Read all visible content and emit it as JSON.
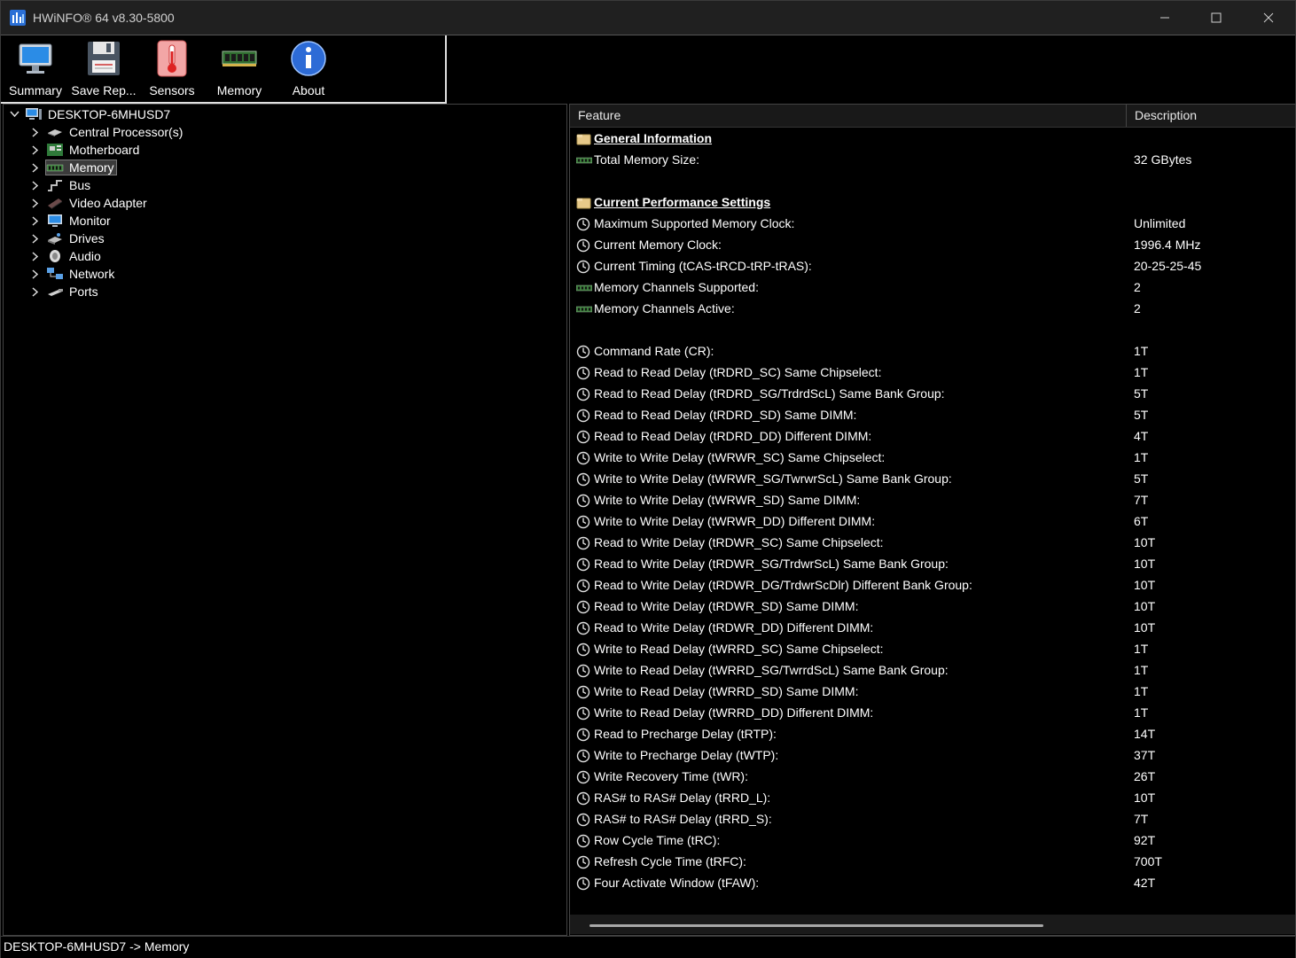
{
  "window": {
    "title": "HWiNFO® 64 v8.30-5800"
  },
  "toolbar": {
    "buttons": [
      {
        "label": "Summary",
        "icon": "monitor-icon"
      },
      {
        "label": "Save Rep...",
        "icon": "floppy-disk-icon"
      },
      {
        "label": "Sensors",
        "icon": "thermometer-icon"
      },
      {
        "label": "Memory",
        "icon": "memory-module-icon"
      },
      {
        "label": "About",
        "icon": "info-icon"
      }
    ]
  },
  "tree": {
    "root": {
      "label": "DESKTOP-6MHUSD7",
      "icon": "computer-icon",
      "expanded": true
    },
    "items": [
      {
        "label": "Central Processor(s)",
        "icon": "cpu-icon"
      },
      {
        "label": "Motherboard",
        "icon": "motherboard-icon"
      },
      {
        "label": "Memory",
        "icon": "memory-module-icon",
        "selected": true
      },
      {
        "label": "Bus",
        "icon": "bus-icon"
      },
      {
        "label": "Video Adapter",
        "icon": "video-card-icon"
      },
      {
        "label": "Monitor",
        "icon": "monitor-icon"
      },
      {
        "label": "Drives",
        "icon": "drive-icon"
      },
      {
        "label": "Audio",
        "icon": "speaker-icon"
      },
      {
        "label": "Network",
        "icon": "network-icon"
      },
      {
        "label": "Ports",
        "icon": "port-icon"
      }
    ]
  },
  "list": {
    "headers": {
      "feature": "Feature",
      "description": "Description"
    },
    "rows": [
      {
        "type": "section",
        "icon": "folder-icon",
        "feature": "General Information",
        "value": ""
      },
      {
        "type": "item",
        "icon": "memory-module-icon",
        "feature": "Total Memory Size:",
        "value": "32 GBytes"
      },
      {
        "type": "blank"
      },
      {
        "type": "section",
        "icon": "folder-icon",
        "feature": "Current Performance Settings",
        "value": ""
      },
      {
        "type": "item",
        "icon": "clock-icon",
        "feature": "Maximum Supported Memory Clock:",
        "value": "Unlimited"
      },
      {
        "type": "item",
        "icon": "clock-icon",
        "feature": "Current Memory Clock:",
        "value": "1996.4 MHz"
      },
      {
        "type": "item",
        "icon": "clock-icon",
        "feature": "Current Timing (tCAS-tRCD-tRP-tRAS):",
        "value": "20-25-25-45"
      },
      {
        "type": "item",
        "icon": "memory-module-icon",
        "feature": "Memory Channels Supported:",
        "value": "2"
      },
      {
        "type": "item",
        "icon": "memory-module-icon",
        "feature": "Memory Channels Active:",
        "value": "2"
      },
      {
        "type": "blank"
      },
      {
        "type": "item",
        "icon": "clock-icon",
        "feature": "Command Rate (CR):",
        "value": "1T"
      },
      {
        "type": "item",
        "icon": "clock-icon",
        "feature": "Read to Read Delay (tRDRD_SC) Same Chipselect:",
        "value": "1T"
      },
      {
        "type": "item",
        "icon": "clock-icon",
        "feature": "Read to Read Delay (tRDRD_SG/TrdrdScL) Same Bank Group:",
        "value": "5T"
      },
      {
        "type": "item",
        "icon": "clock-icon",
        "feature": "Read to Read Delay (tRDRD_SD) Same DIMM:",
        "value": "5T"
      },
      {
        "type": "item",
        "icon": "clock-icon",
        "feature": "Read to Read Delay (tRDRD_DD) Different DIMM:",
        "value": "4T"
      },
      {
        "type": "item",
        "icon": "clock-icon",
        "feature": "Write to Write Delay (tWRWR_SC) Same Chipselect:",
        "value": "1T"
      },
      {
        "type": "item",
        "icon": "clock-icon",
        "feature": "Write to Write Delay (tWRWR_SG/TwrwrScL) Same Bank Group:",
        "value": "5T"
      },
      {
        "type": "item",
        "icon": "clock-icon",
        "feature": "Write to Write Delay (tWRWR_SD) Same DIMM:",
        "value": "7T"
      },
      {
        "type": "item",
        "icon": "clock-icon",
        "feature": "Write to Write Delay (tWRWR_DD) Different DIMM:",
        "value": "6T"
      },
      {
        "type": "item",
        "icon": "clock-icon",
        "feature": "Read to Write Delay (tRDWR_SC) Same Chipselect:",
        "value": "10T"
      },
      {
        "type": "item",
        "icon": "clock-icon",
        "feature": "Read to Write Delay (tRDWR_SG/TrdwrScL) Same Bank Group:",
        "value": "10T"
      },
      {
        "type": "item",
        "icon": "clock-icon",
        "feature": "Read to Write Delay (tRDWR_DG/TrdwrScDlr) Different Bank Group:",
        "value": "10T"
      },
      {
        "type": "item",
        "icon": "clock-icon",
        "feature": "Read to Write Delay (tRDWR_SD) Same DIMM:",
        "value": "10T"
      },
      {
        "type": "item",
        "icon": "clock-icon",
        "feature": "Read to Write Delay (tRDWR_DD) Different DIMM:",
        "value": "10T"
      },
      {
        "type": "item",
        "icon": "clock-icon",
        "feature": "Write to Read Delay (tWRRD_SC) Same Chipselect:",
        "value": "1T"
      },
      {
        "type": "item",
        "icon": "clock-icon",
        "feature": "Write to Read Delay (tWRRD_SG/TwrrdScL) Same Bank Group:",
        "value": "1T"
      },
      {
        "type": "item",
        "icon": "clock-icon",
        "feature": "Write to Read Delay (tWRRD_SD) Same DIMM:",
        "value": "1T"
      },
      {
        "type": "item",
        "icon": "clock-icon",
        "feature": "Write to Read Delay (tWRRD_DD) Different DIMM:",
        "value": "1T"
      },
      {
        "type": "item",
        "icon": "clock-icon",
        "feature": "Read to Precharge Delay (tRTP):",
        "value": "14T"
      },
      {
        "type": "item",
        "icon": "clock-icon",
        "feature": "Write to Precharge Delay (tWTP):",
        "value": "37T"
      },
      {
        "type": "item",
        "icon": "clock-icon",
        "feature": "Write Recovery Time (tWR):",
        "value": "26T"
      },
      {
        "type": "item",
        "icon": "clock-icon",
        "feature": "RAS# to RAS# Delay (tRRD_L):",
        "value": "10T"
      },
      {
        "type": "item",
        "icon": "clock-icon",
        "feature": "RAS# to RAS# Delay (tRRD_S):",
        "value": "7T"
      },
      {
        "type": "item",
        "icon": "clock-icon",
        "feature": "Row Cycle Time (tRC):",
        "value": "92T"
      },
      {
        "type": "item",
        "icon": "clock-icon",
        "feature": "Refresh Cycle Time (tRFC):",
        "value": "700T"
      },
      {
        "type": "item",
        "icon": "clock-icon",
        "feature": "Four Activate Window (tFAW):",
        "value": "42T"
      }
    ]
  },
  "statusbar": {
    "text": "DESKTOP-6MHUSD7 -> Memory"
  },
  "colors": {
    "background": "#000000",
    "titlebar": "#202020",
    "text": "#ffffff",
    "selection": "#3b3b3b"
  }
}
